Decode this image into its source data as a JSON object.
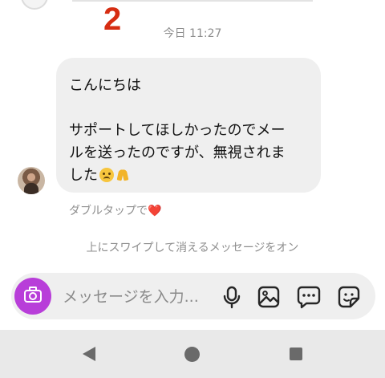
{
  "annotation": {
    "number": "2",
    "color": "#d62d12"
  },
  "thread": {
    "timestamp": "今日 11:27",
    "message": {
      "lines": [
        "こんにちは",
        "サポートしてほしかったのでメー",
        "ルを送ったのですが、無視されま",
        "した"
      ],
      "emojis": [
        "crying-face",
        "folded-hands"
      ]
    },
    "double_tap_hint": "ダブルタップで",
    "double_tap_icon": "heart-icon",
    "vanish_mode_hint": "上にスワイプして消えるメッセージをオン"
  },
  "composer": {
    "placeholder": "メッセージを入力...",
    "camera_color": "#b83ed9",
    "icons": [
      "camera-icon",
      "microphone-icon",
      "gallery-icon",
      "chat-bubble-icon",
      "sticker-icon"
    ]
  },
  "navbar": {
    "icons": [
      "back-icon",
      "home-icon",
      "recent-apps-icon"
    ]
  }
}
